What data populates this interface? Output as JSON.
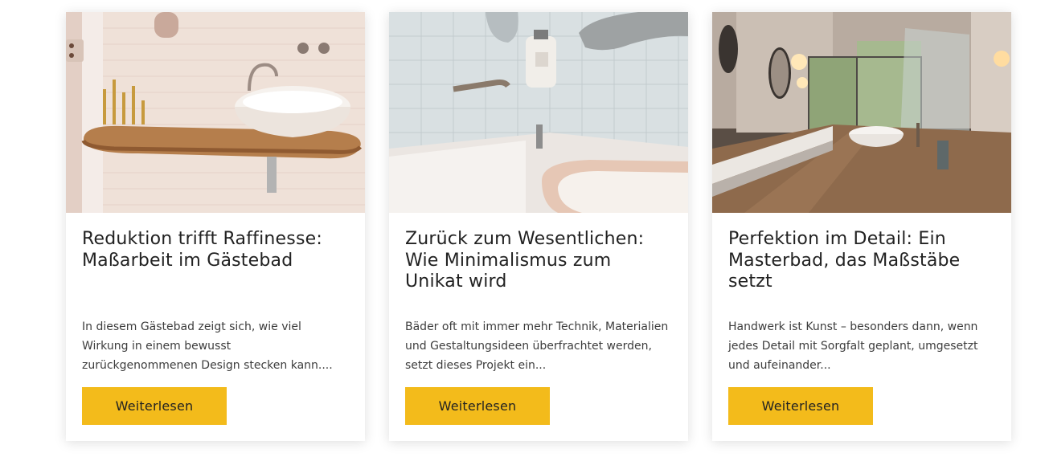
{
  "cards": [
    {
      "title": "Reduktion trifft Raffinesse: Maßarbeit im Gästebad",
      "excerpt": "In diesem Gästebad zeigt sich, wie viel Wirkung in einem bewusst zurückgenommenen Design stecken kann....",
      "button": "Weiterlesen"
    },
    {
      "title": "Zurück zum Wesentlichen: Wie Minimalismus zum Unikat wird",
      "excerpt": "Bäder oft mit immer mehr Technik, Materialien und Gestaltungsideen überfrachtet werden, setzt dieses Projekt ein...",
      "button": "Weiterlesen"
    },
    {
      "title": "Perfektion im Detail: Ein Masterbad, das Maßstäbe setzt",
      "excerpt": "Handwerk ist Kunst – besonders dann, wenn jedes Detail mit Sorgfalt geplant, umgesetzt und aufeinander...",
      "button": "Weiterlesen"
    }
  ],
  "colors": {
    "button": "#f3bb1b",
    "title": "#222222",
    "text": "#3d3d3d"
  }
}
